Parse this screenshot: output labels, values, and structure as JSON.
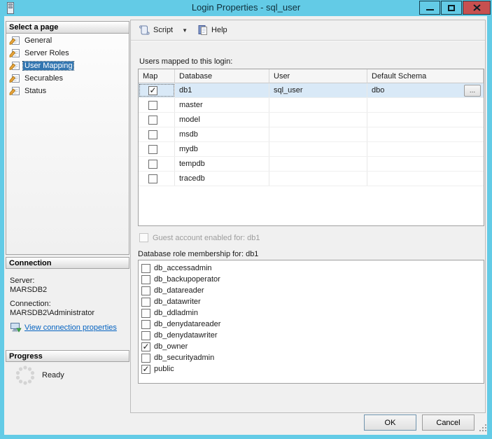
{
  "titlebar": {
    "title": "Login Properties - sql_user"
  },
  "sidebar": {
    "pages": {
      "header": "Select a page",
      "items": [
        {
          "label": "General"
        },
        {
          "label": "Server Roles"
        },
        {
          "label": "User Mapping"
        },
        {
          "label": "Securables"
        },
        {
          "label": "Status"
        }
      ]
    },
    "connection": {
      "header": "Connection",
      "server_label": "Server:",
      "server_value": "MARSDB2",
      "connection_label": "Connection:",
      "connection_value": "MARSDB2\\Administrator",
      "link_label": "View connection properties"
    },
    "progress": {
      "header": "Progress",
      "status": "Ready"
    }
  },
  "toolbar": {
    "script_label": "Script",
    "dropdown_glyph": "▼",
    "help_label": "Help"
  },
  "mapping": {
    "users_mapped_label": "Users mapped to this login:",
    "columns": [
      "Map",
      "Database",
      "User",
      "Default Schema"
    ],
    "rows": [
      {
        "map": "✓",
        "database": "db1",
        "user": "sql_user",
        "schema": "dbo"
      },
      {
        "map": "",
        "database": "master",
        "user": "",
        "schema": ""
      },
      {
        "map": "",
        "database": "model",
        "user": "",
        "schema": ""
      },
      {
        "map": "",
        "database": "msdb",
        "user": "",
        "schema": ""
      },
      {
        "map": "",
        "database": "mydb",
        "user": "",
        "schema": ""
      },
      {
        "map": "",
        "database": "tempdb",
        "user": "",
        "schema": ""
      },
      {
        "map": "",
        "database": "tracedb",
        "user": "",
        "schema": ""
      }
    ],
    "browse_label": "...",
    "guest_label": "Guest account enabled for: db1",
    "roles_label": "Database role membership for: db1",
    "roles": [
      {
        "check": "",
        "name": "db_accessadmin"
      },
      {
        "check": "",
        "name": "db_backupoperator"
      },
      {
        "check": "",
        "name": "db_datareader"
      },
      {
        "check": "",
        "name": "db_datawriter"
      },
      {
        "check": "",
        "name": "db_ddladmin"
      },
      {
        "check": "",
        "name": "db_denydatareader"
      },
      {
        "check": "",
        "name": "db_denydatawriter"
      },
      {
        "check": "✓",
        "name": "db_owner"
      },
      {
        "check": "",
        "name": "db_securityadmin"
      },
      {
        "check": "✓",
        "name": "public"
      }
    ]
  },
  "footer": {
    "ok_label": "OK",
    "cancel_label": "Cancel"
  },
  "colors": {
    "titlebar": "#63cbe6",
    "close_button": "#c75050",
    "selection": "#3276b1",
    "row_highlight": "#d9e9f7",
    "link": "#0563c1"
  }
}
